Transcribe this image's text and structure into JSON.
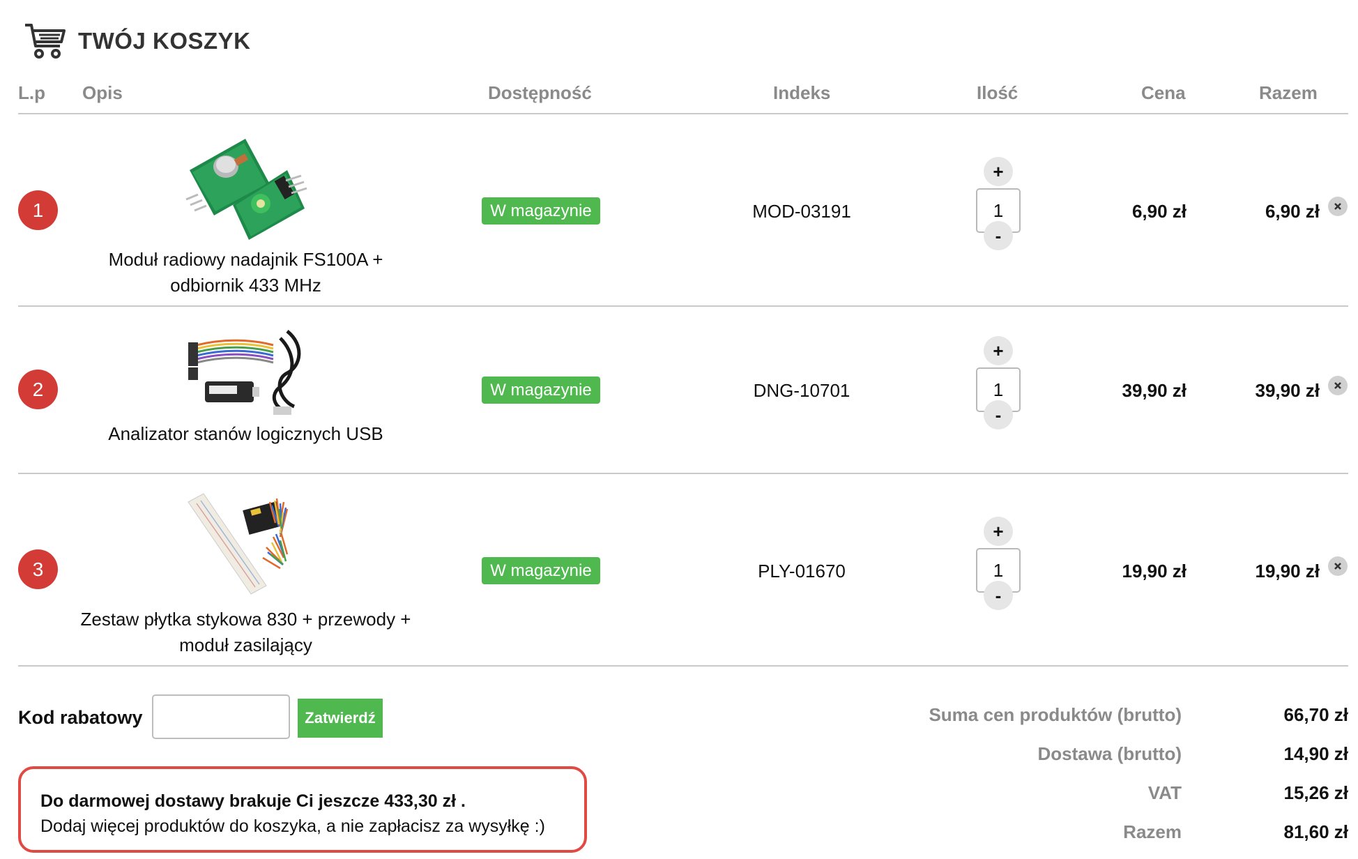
{
  "header": {
    "title": "TWÓJ KOSZYK",
    "icon": "cart-icon"
  },
  "columns": {
    "lp": "L.p",
    "opis": "Opis",
    "dostepnosc": "Dostępność",
    "indeks": "Indeks",
    "ilosc": "Ilość",
    "cena": "Cena",
    "razem": "Razem"
  },
  "items": [
    {
      "lp": "1",
      "name": "Moduł radiowy nadajnik FS100A + odbiornik 433 MHz",
      "stock": "W magazynie",
      "sku": "MOD-03191",
      "qty": "1",
      "price": "6,90 zł",
      "total": "6,90 zł"
    },
    {
      "lp": "2",
      "name": "Analizator stanów logicznych USB",
      "stock": "W magazynie",
      "sku": "DNG-10701",
      "qty": "1",
      "price": "39,90 zł",
      "total": "39,90 zł"
    },
    {
      "lp": "3",
      "name": "Zestaw płytka stykowa 830 + przewody + moduł zasilający",
      "stock": "W magazynie",
      "sku": "PLY-01670",
      "qty": "1",
      "price": "19,90 zł",
      "total": "19,90 zł"
    }
  ],
  "qty_controls": {
    "plus": "+",
    "minus": "-"
  },
  "coupon": {
    "label": "Kod rabatowy",
    "value": "",
    "button": "Zatwierdź"
  },
  "free_shipping": {
    "line1": "Do darmowej dostawy brakuje Ci jeszcze 433,30 zł .",
    "line2": "Dodaj więcej produktów do koszyka, a nie zapłacisz za wysyłkę :)"
  },
  "summary": [
    {
      "label": "Suma cen produktów (brutto)",
      "value": "66,70 zł"
    },
    {
      "label": "Dostawa (brutto)",
      "value": "14,90 zł"
    },
    {
      "label": "VAT",
      "value": "15,26 zł"
    },
    {
      "label": "Razem",
      "value": "81,60 zł"
    }
  ],
  "colors": {
    "badge": "#d33b36",
    "stock": "#4fb84f",
    "button": "#4fb84f",
    "alert_border": "#e04a43"
  }
}
